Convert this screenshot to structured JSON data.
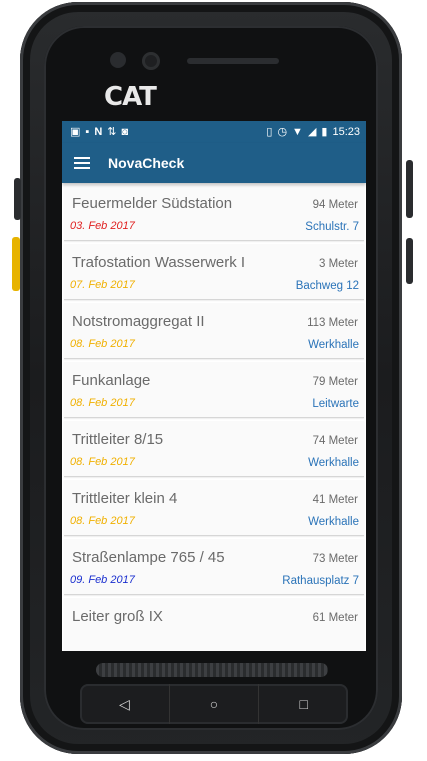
{
  "device": {
    "brand_logo": "CAT"
  },
  "status_bar": {
    "left_icons": [
      "photo-notification-icon",
      "image-icon",
      "n-icon",
      "signal-arrows-icon",
      "chat-icon"
    ],
    "right_icons": [
      "vibrate-icon",
      "alarm-icon",
      "wifi-icon",
      "cell-signal-icon",
      "battery-icon"
    ],
    "time": "15:23"
  },
  "app_bar": {
    "title": "NovaCheck",
    "menu_icon": "hamburger-menu-icon"
  },
  "list": [
    {
      "name": "Feuermelder Südstation",
      "date": "03. Feb 2017",
      "date_color": "#e02020",
      "distance": "94 Meter",
      "location": "Schulstr. 7"
    },
    {
      "name": "Trafostation Wasserwerk I",
      "date": "07. Feb 2017",
      "date_color": "#f0b000",
      "distance": "3 Meter",
      "location": "Bachweg 12"
    },
    {
      "name": "Notstromaggregat II",
      "date": "08. Feb 2017",
      "date_color": "#f0b000",
      "distance": "113 Meter",
      "location": "Werkhalle"
    },
    {
      "name": "Funkanlage",
      "date": "08. Feb 2017",
      "date_color": "#f0b000",
      "distance": "79 Meter",
      "location": "Leitwarte"
    },
    {
      "name": "Trittleiter 8/15",
      "date": "08. Feb 2017",
      "date_color": "#f0b000",
      "distance": "74 Meter",
      "location": "Werkhalle"
    },
    {
      "name": "Trittleiter klein 4",
      "date": "08. Feb 2017",
      "date_color": "#f0b000",
      "distance": "41 Meter",
      "location": "Werkhalle"
    },
    {
      "name": "Straßenlampe 765 / 45",
      "date": "09. Feb 2017",
      "date_color": "#1a2fcf",
      "distance": "73 Meter",
      "location": "Rathausplatz 7"
    },
    {
      "name": "Leiter groß IX",
      "date": "",
      "date_color": "#f0b000",
      "distance": "61 Meter",
      "location": ""
    }
  ],
  "nav_bar": {
    "back_icon": "back-triangle-icon",
    "home_icon": "home-circle-icon",
    "recents_icon": "recents-square-icon"
  },
  "colors": {
    "primary": "#1f5e88",
    "location_text": "#2a73b8"
  }
}
